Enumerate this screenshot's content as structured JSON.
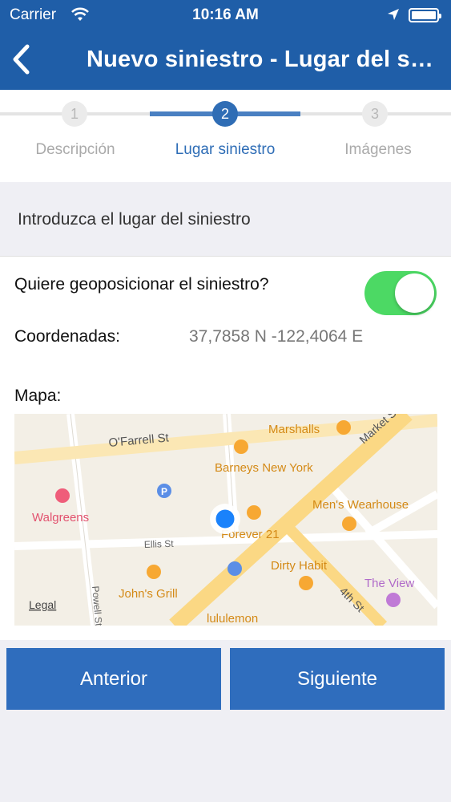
{
  "status_bar": {
    "carrier": "Carrier",
    "time": "10:16 AM",
    "icons": [
      "wifi-icon",
      "location-arrow-icon",
      "battery-icon"
    ]
  },
  "nav": {
    "back_icon": "chevron-left-icon",
    "title": "Nuevo siniestro - Lugar del siniestro"
  },
  "steps": [
    {
      "number": "1",
      "label": "Descripción",
      "state": "inactive"
    },
    {
      "number": "2",
      "label": "Lugar siniestro",
      "state": "active"
    },
    {
      "number": "3",
      "label": "Imágenes",
      "state": "inactive"
    }
  ],
  "section": {
    "title": "Introduzca el lugar del siniestro"
  },
  "form": {
    "geoposition_label": "Quiere geoposicionar el siniestro?",
    "geoposition_enabled": true,
    "coordinates_label": "Coordenadas:",
    "coordinates_value": "37,7858 N -122,4064 E",
    "map_label": "Mapa:"
  },
  "map": {
    "streets": [
      "O'Farrell St",
      "Ellis St",
      "Powell St",
      "Market St",
      "4th St"
    ],
    "places": [
      "Marshalls",
      "Barneys New York",
      "Men's Wearhouse",
      "Walgreens",
      "Forever 21",
      "Dirty Habit",
      "John's Grill",
      "The View",
      "lululemon"
    ],
    "legal_label": "Legal"
  },
  "buttons": {
    "previous": "Anterior",
    "next": "Siguiente"
  },
  "colors": {
    "nav_bg": "#1f5ea8",
    "accent": "#2f6dbd",
    "toggle_on": "#4cd964",
    "map_pin": "#1a82fb"
  }
}
